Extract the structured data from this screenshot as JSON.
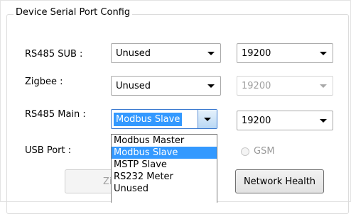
{
  "group": {
    "title": "Device Serial Port Config"
  },
  "rows": {
    "rs485_sub": {
      "label": "RS485 SUB :",
      "port_value": "Unused",
      "baud_value": "19200"
    },
    "zigbee": {
      "label": "Zigbee :",
      "port_value": "Unused",
      "baud_value": "19200"
    },
    "rs485_main": {
      "label": "RS485 Main :",
      "port_value": "Modbus Slave",
      "baud_value": "19200"
    },
    "usb_port": {
      "label": "USB Port :"
    }
  },
  "dropdown": {
    "options": [
      "Modbus Master",
      "Modbus Slave",
      "MSTP Slave",
      "RS232 Meter",
      "Unused"
    ],
    "selected_index": 1
  },
  "gsm": {
    "label": "GSM"
  },
  "buttons": {
    "zigbee_partial": "Zigb",
    "network_health": "Network Health"
  },
  "colors": {
    "selection": "#3399ff",
    "disabled_text": "#a0a0a0"
  }
}
